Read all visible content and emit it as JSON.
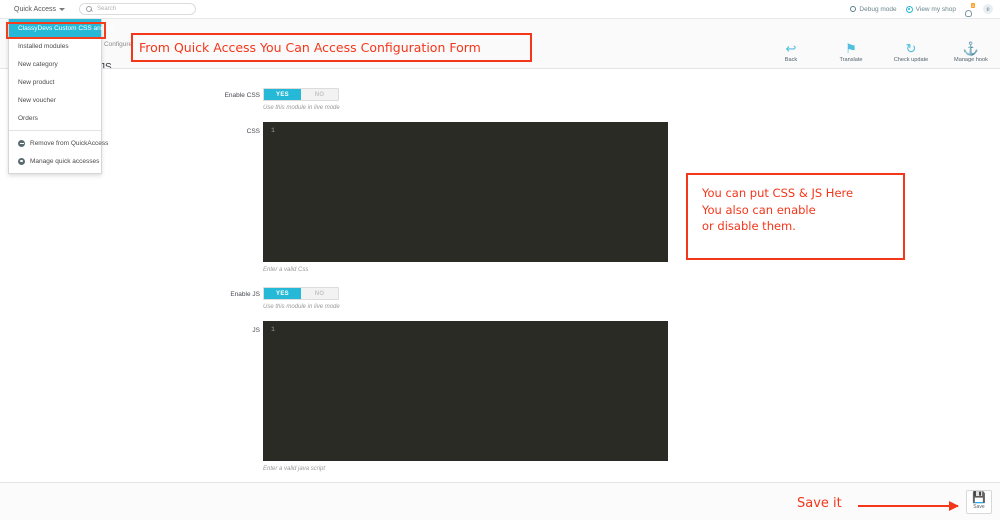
{
  "topbar": {
    "quick_access_label": "Quick Access",
    "search_placeholder": "Search",
    "debug_mode": "Debug mode",
    "view_my_shop": "View my shop",
    "notification_count": "0",
    "avatar_initial": "e"
  },
  "quick_access_menu": {
    "items": [
      {
        "label": "ClassyDevs Custom CSS and JS",
        "active": true
      },
      {
        "label": "Installed modules",
        "active": false
      },
      {
        "label": "New category",
        "active": false
      },
      {
        "label": "New product",
        "active": false
      },
      {
        "label": "New voucher",
        "active": false
      },
      {
        "label": "Orders",
        "active": false
      }
    ],
    "footer_items": [
      {
        "label": "Remove from QuickAccess",
        "icon": "minus-circle-icon"
      },
      {
        "label": "Manage quick accesses",
        "icon": "gear-icon"
      }
    ]
  },
  "page": {
    "breadcrumb": "› Configure",
    "title": "JS"
  },
  "head_tools": [
    {
      "label": "Back",
      "icon": "back-arrow-icon",
      "glyph": "↩"
    },
    {
      "label": "Translate",
      "icon": "flag-icon",
      "glyph": "⚑"
    },
    {
      "label": "Check update",
      "icon": "refresh-icon",
      "glyph": "↻"
    },
    {
      "label": "Manage hook",
      "icon": "anchor-icon",
      "glyph": "⚓"
    }
  ],
  "form": {
    "enable_css": {
      "label": "Enable CSS",
      "on_label": "YES",
      "off_label": "NO",
      "value": "YES",
      "hint": "Use this module in live mode"
    },
    "css_field": {
      "label": "CSS",
      "line_number": "1",
      "value": "",
      "hint": "Enter a valid Css"
    },
    "enable_js": {
      "label": "Enable JS",
      "on_label": "YES",
      "off_label": "NO",
      "value": "YES",
      "hint": "Use this module in live mode"
    },
    "js_field": {
      "label": "JS",
      "line_number": "1",
      "value": "",
      "hint": "Enter a valid java script"
    }
  },
  "footer": {
    "save_label": "Save"
  },
  "annotations": {
    "quick_access_note": "From Quick Access You Can Access Configuration Form",
    "editor_note_line1": "You can put CSS & JS Here",
    "editor_note_line2": "You also can enable",
    "editor_note_line3": "or disable them.",
    "save_note": "Save it"
  },
  "colors": {
    "accent": "#25b9d7",
    "annotation_red": "#f4361a",
    "editor_bg": "#2b2b26",
    "badge_orange": "#fb9f2a"
  }
}
